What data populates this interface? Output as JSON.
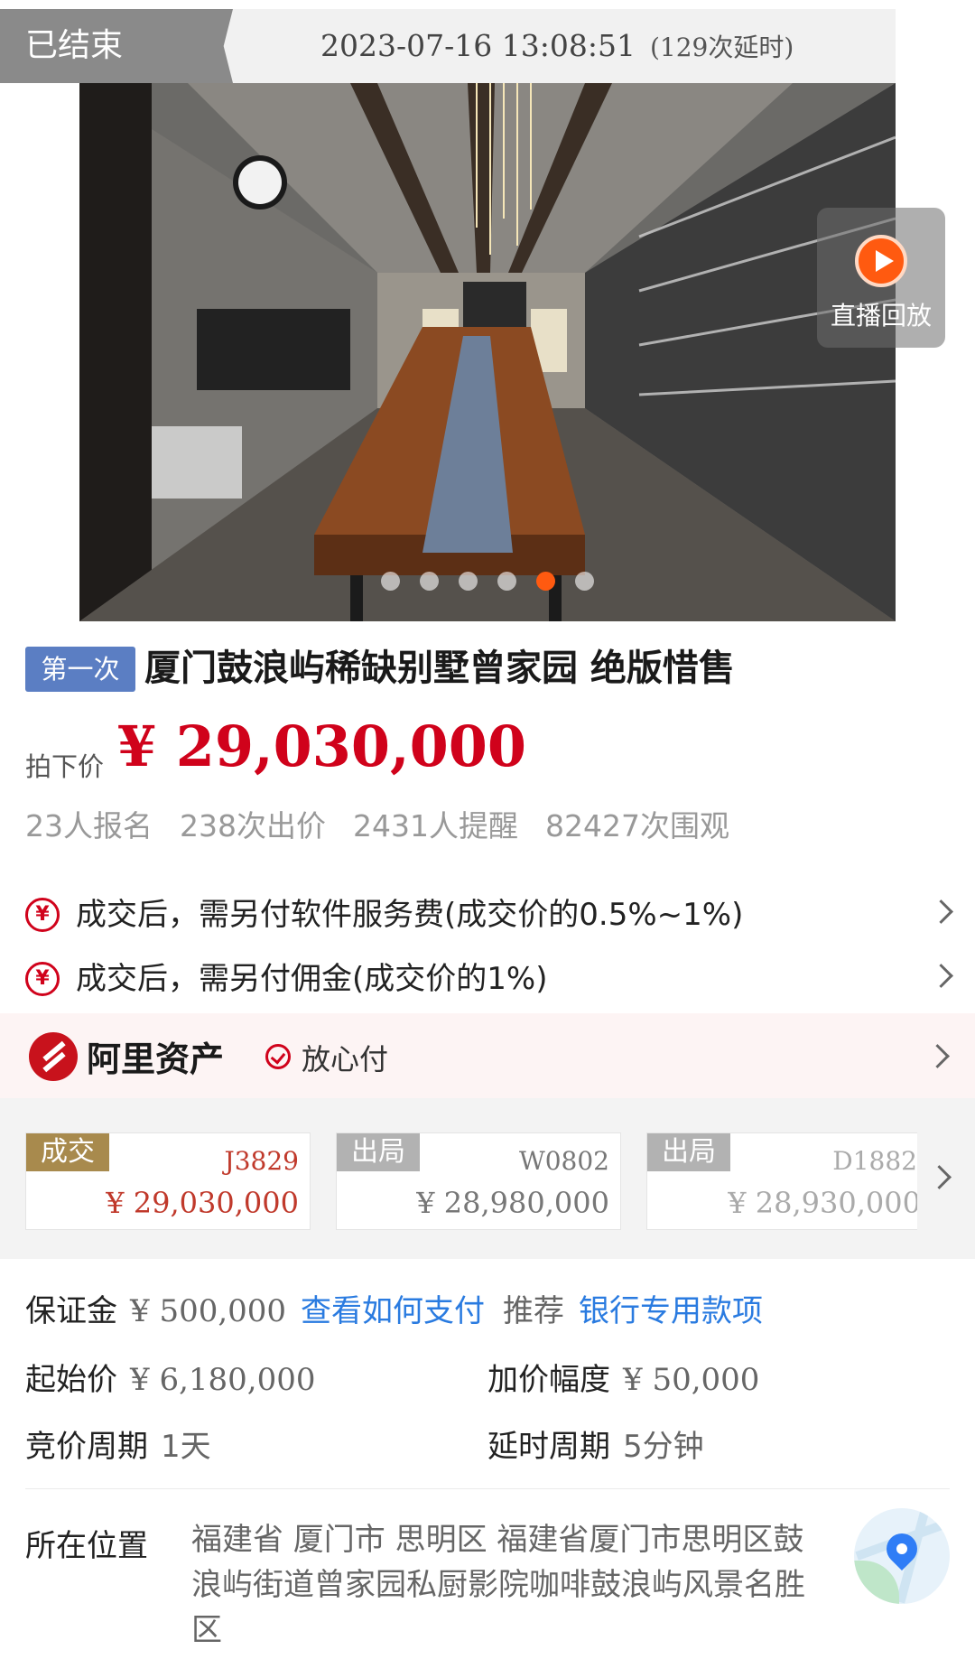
{
  "header": {
    "status": "已结束",
    "end_time": "2023-07-16 13:08:51",
    "extensions": "(129次延时)"
  },
  "gallery": {
    "replay_label": "直播回放",
    "image_count": 6,
    "active_index": 5
  },
  "item": {
    "round_badge": "第一次",
    "title": "厦门鼓浪屿稀缺别墅曾家园 绝版惜售",
    "price_label": "拍下价",
    "price": "¥ 29,030,000",
    "stats": [
      "23人报名",
      "238次出价",
      "2431人提醒",
      "82427次围观"
    ]
  },
  "fees": [
    {
      "icon": "¥",
      "text": "成交后，需另付软件服务费(成交价的0.5%~1%)"
    },
    {
      "icon": "¥",
      "text": "成交后，需另付佣金(成交价的1%)"
    }
  ],
  "platform": {
    "name": "阿里资产",
    "assurance": "放心付"
  },
  "bids": [
    {
      "tag": "成交",
      "code": "J3829",
      "amount": "¥ 29,030,000",
      "tag_color": "#a88a4d",
      "text_color": "#c0392b"
    },
    {
      "tag": "出局",
      "code": "W0802",
      "amount": "¥ 28,980,000",
      "tag_color": "#b2b2b2",
      "text_color": "#777777"
    },
    {
      "tag": "出局",
      "code": "D1882",
      "amount": "¥ 28,930,000",
      "tag_color": "#b2b2b2",
      "text_color": "#aaaaaa"
    }
  ],
  "details": {
    "deposit_label": "保证金",
    "deposit": "¥ 500,000",
    "deposit_link": "查看如何支付",
    "recommend_label": "推荐",
    "recommend_link": "银行专用款项",
    "start_label": "起始价",
    "start_price": "¥ 6,180,000",
    "increment_label": "加价幅度",
    "increment": "¥ 50,000",
    "cycle_label": "竞价周期",
    "cycle": "1天",
    "delay_label": "延时周期",
    "delay": "5分钟"
  },
  "location": {
    "label": "所在位置",
    "address": "福建省 厦门市 思明区 福建省厦门市思明区鼓浪屿街道曾家园私厨影院咖啡鼓浪屿风景名胜区"
  },
  "colors": {
    "price_red": "#d0021b",
    "accent_orange": "#ff5a10",
    "link_blue": "#2a7be0",
    "badge_blue": "#5b7ec3"
  }
}
